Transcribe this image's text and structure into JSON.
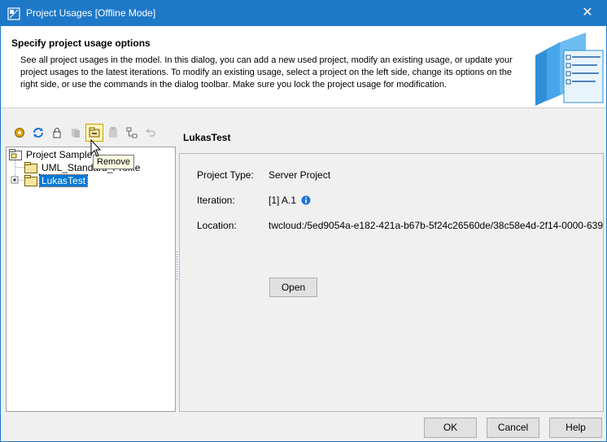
{
  "window": {
    "title": "Project Usages [Offline Mode]",
    "close_symbol": "✕"
  },
  "header": {
    "title": "Specify project usage options",
    "description": "See all project usages in the model. In this dialog, you can add a new used project, modify an existing usage, or update your project usages to the latest iterations. To modify an existing usage, select a project on the left side, change its options on the right side, or use the commands in the dialog toolbar. Make sure you lock the project usage for modification."
  },
  "toolbar": {
    "buttons": [
      "gear-icon",
      "refresh-icon",
      "lock-icon",
      "copy-icon",
      "remove-icon",
      "paste-icon",
      "diagram-icon",
      "undo-icon"
    ],
    "tooltip": "Remove"
  },
  "tree": {
    "items": [
      {
        "label": "Project Sample"
      },
      {
        "label": "UML_Standard_Profile"
      },
      {
        "label": "LukasTest",
        "selected": true
      }
    ]
  },
  "detail": {
    "title": "LukasTest",
    "project_type_label": "Project Type:",
    "project_type_value": "Server Project",
    "iteration_label": "Iteration:",
    "iteration_value": "[1] A.1",
    "location_label": "Location:",
    "location_value": "twcloud:/5ed9054a-e182-421a-b67b-5f24c26560de/38c58e4d-2f14-0000-639",
    "open_label": "Open"
  },
  "footer": {
    "ok_label": "OK",
    "cancel_label": "Cancel",
    "help_label": "Help"
  },
  "colors": {
    "titlebar": "#1e78c8",
    "selection": "#0078d7",
    "info_icon": "#1a73d9"
  }
}
